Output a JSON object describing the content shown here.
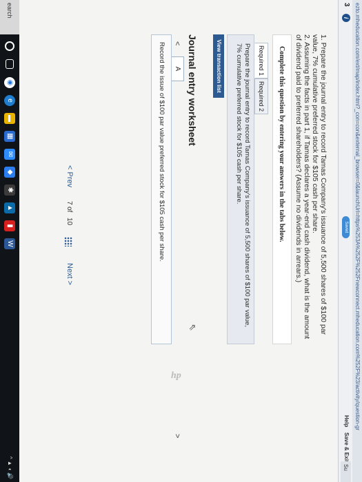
{
  "browser": {
    "url": "ezto.mheducation.com/ext/map/index.html?_con=con&external_browser=0&launchUrl=https%253A%252F%252Fnewconnect.mheducation.com%252F%23/activity/question-gr"
  },
  "header": {
    "question_number": "3",
    "info_icon": "i",
    "saved_label": "Saved",
    "help_label": "Help",
    "save_exit_label": "Save & Exit",
    "submit_label": "Su"
  },
  "question": {
    "part1": "1. Prepare the journal entry to record Tamas Company's issuance of 5,500 shares of $100 par value, 7% cumulative preferred stock for $105 cash per share.",
    "part2": "2. Assuming the facts in part 1, if Tamas declares a year-end cash dividend, what is the amount of dividend paid to preferred shareholders? (Assume no dividends in arrears.)"
  },
  "instructions": "Complete this question by entering your answers in the tabs below.",
  "tabs": [
    {
      "label": "Required 1"
    },
    {
      "label": "Required 2"
    }
  ],
  "prompt": "Prepare the journal entry to record Tamas Company's issuance of 5,500 shares of $100 par value, 7% cumulative preferred stock for $105 cash per share.",
  "view_transaction_label": "View transaction list",
  "worksheet": {
    "title": "Journal entry worksheet",
    "nav_left": "<",
    "nav_right": ">",
    "tab_label": "A",
    "entry_text": "Record the issue of $100 par value preferred stock for $105 cash per share."
  },
  "pager": {
    "prev_label": "< Prev",
    "current": "7",
    "of_label": "of",
    "total": "10",
    "next_label": "Next >"
  },
  "taskbar": {
    "search_label": "earch",
    "tray_text": "^ ▲ ◖ 🔊"
  },
  "logo_text": "hp",
  "icons": {
    "info": "info-icon",
    "cursor": "cursor-icon",
    "grid": "grid-icon"
  },
  "colors": {
    "accent": "#2c5a91",
    "saved_badge": "#3f8ad4",
    "taskbar": "#101418"
  }
}
